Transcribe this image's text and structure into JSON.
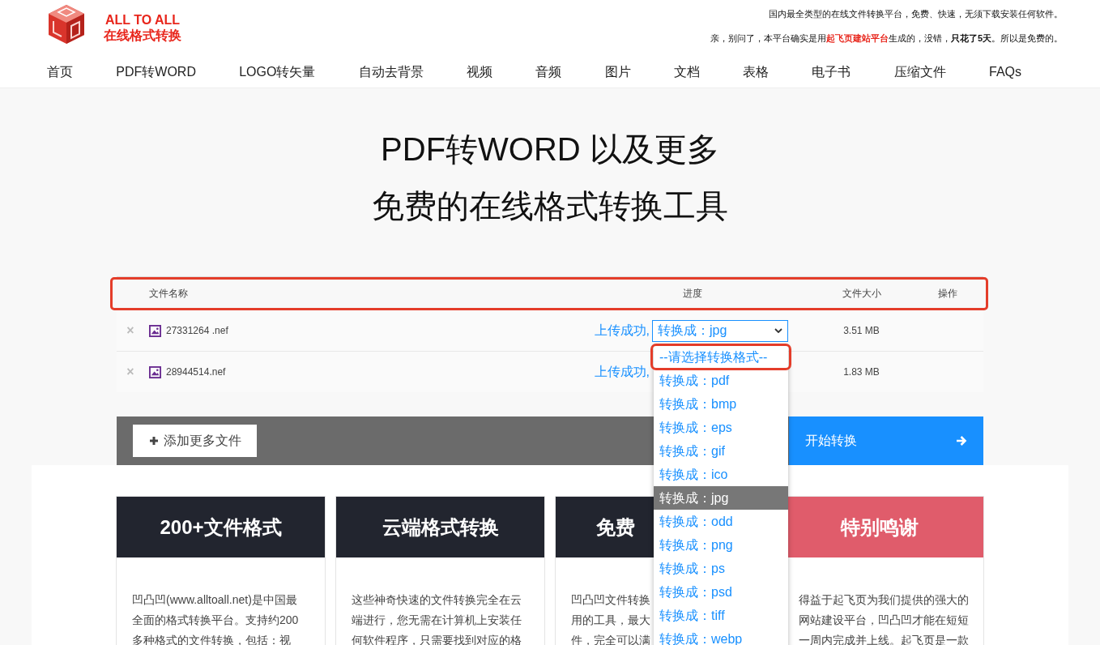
{
  "logo": {
    "title": "ALL TO ALL",
    "subtitle": "在线格式转换"
  },
  "notice": {
    "line_1": "国内最全类型的在线文件转换平台，免费、快速，无须下载安装任何软件。",
    "line_2": [
      {
        "text": "亲，别问了，本平台确实是用",
        "kind": "plain"
      },
      {
        "text": "起飞页建站平台",
        "kind": "brand"
      },
      {
        "text": "生成的，没错，",
        "kind": "plain"
      },
      {
        "text": "只花了5天",
        "kind": "bold"
      },
      {
        "text": "。所以是免费的。",
        "kind": "plain"
      }
    ]
  },
  "nav": [
    "首页",
    "PDF转WORD",
    "LOGO转矢量",
    "自动去背景",
    "视频",
    "音频",
    "图片",
    "文档",
    "表格",
    "电子书",
    "压缩文件",
    "FAQs"
  ],
  "hero": {
    "title": "PDF转WORD 以及更多",
    "subtitle": "免费的在线格式转换工具"
  },
  "table": {
    "columns": [
      "文件名称",
      "进度",
      "文件大小",
      "操作"
    ],
    "header_highlighted": true,
    "rows": [
      {
        "remove": "×",
        "name": "27331264 .nef",
        "status": "上传成功,",
        "format": "转换成：jpg",
        "size": "3.51 MB"
      },
      {
        "remove": "×",
        "name": "28944514.nef",
        "status": "上传成功,",
        "size": "1.83 MB"
      }
    ]
  },
  "dropdown": {
    "options": [
      {
        "label": "--请选择转换格式--",
        "selected": false,
        "highlighted": true
      },
      {
        "label": "转换成：pdf",
        "selected": false,
        "highlighted": false
      },
      {
        "label": "转换成：bmp",
        "selected": false,
        "highlighted": false
      },
      {
        "label": "转换成：eps",
        "selected": false,
        "highlighted": false
      },
      {
        "label": "转换成：gif",
        "selected": false,
        "highlighted": false
      },
      {
        "label": "转换成：ico",
        "selected": false,
        "highlighted": false
      },
      {
        "label": "转换成：jpg",
        "selected": true,
        "highlighted": false
      },
      {
        "label": "转换成：odd",
        "selected": false,
        "highlighted": false
      },
      {
        "label": "转换成：png",
        "selected": false,
        "highlighted": false
      },
      {
        "label": "转换成：ps",
        "selected": false,
        "highlighted": false
      },
      {
        "label": "转换成：psd",
        "selected": false,
        "highlighted": false
      },
      {
        "label": "转换成：tiff",
        "selected": false,
        "highlighted": false
      },
      {
        "label": "转换成：webp",
        "selected": false,
        "highlighted": false
      }
    ]
  },
  "actions": {
    "add": "添加更多文件",
    "start": "开始转换"
  },
  "cards": [
    {
      "title": "200+文件格式",
      "color": "#22252f",
      "kind": "full",
      "lines": [
        "凹凸凹(www.alltoall.net)是中国最",
        "全面的格式转换平台。支持约200",
        "多种格式的文件转换，包括：视"
      ]
    },
    {
      "title": "云端格式转换",
      "color": "#22252f",
      "kind": "full",
      "lines": [
        "这些神奇快速的文件转换完全在云",
        "端进行，您无需在计算机上安装任",
        "何软件程序，只需要找到对应的格"
      ]
    },
    {
      "title": "免费",
      "color": "#22252f",
      "kind": "left",
      "lines": [
        "凹凸凹文件转换",
        "用的工具，最大",
        "件，完全可以满"
      ]
    },
    {
      "title": "特别鸣谢",
      "color": "#e05c6b",
      "kind": "right",
      "lines": [
        "得益于起飞页为我们提供的强大的",
        "网站建设平台，凹凸凹才能在短短",
        "一周内完成并上线。起飞页是一款"
      ]
    }
  ]
}
